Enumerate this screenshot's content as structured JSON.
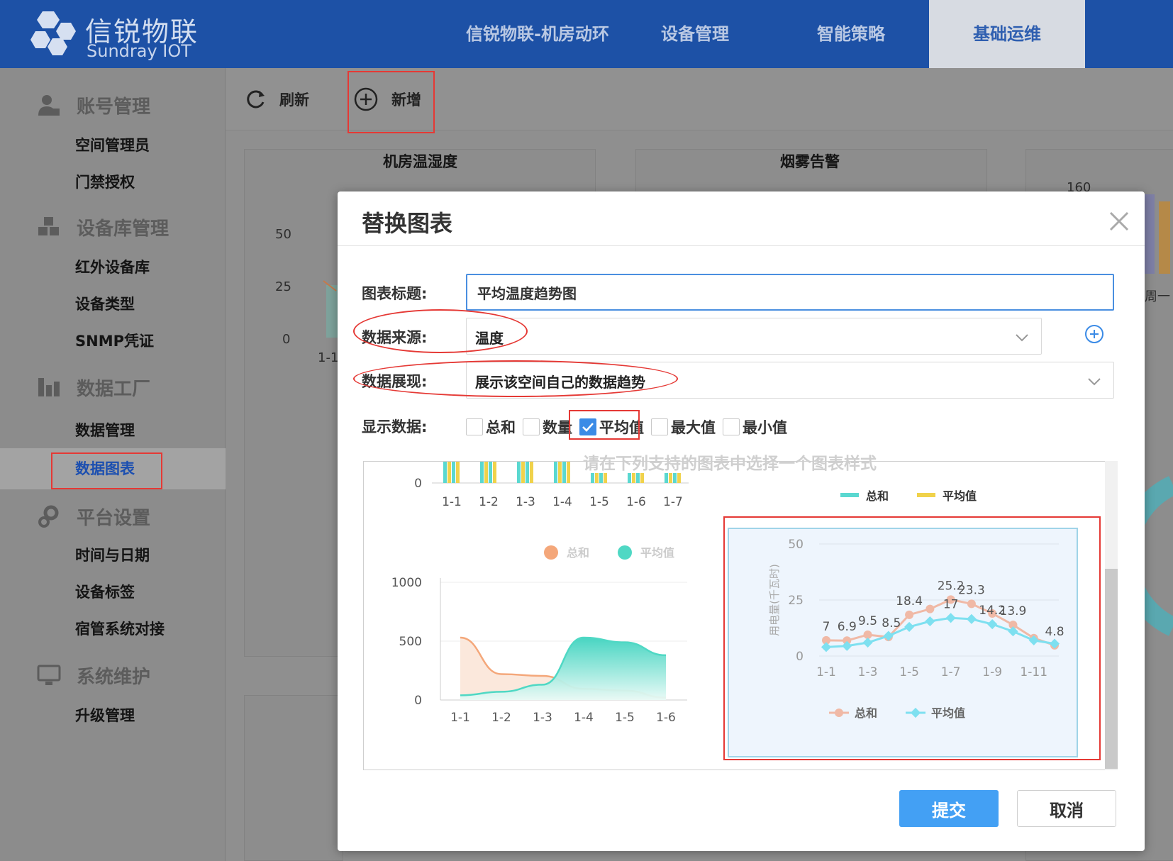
{
  "header": {
    "brand_cn": "信锐物联",
    "brand_en": "Sundray IOT",
    "nav": [
      {
        "label": "信锐物联-机房动环"
      },
      {
        "label": "设备管理"
      },
      {
        "label": "智能策略"
      },
      {
        "label": "基础运维",
        "active": true
      }
    ]
  },
  "sidebar": {
    "groups": [
      {
        "label": "账号管理",
        "icon": "user-icon",
        "items": [
          "空间管理员",
          "门禁授权"
        ]
      },
      {
        "label": "设备库管理",
        "icon": "cubes-icon",
        "items": [
          "红外设备库",
          "设备类型",
          "SNMP凭证"
        ]
      },
      {
        "label": "数据工厂",
        "icon": "chart-icon",
        "items": [
          "数据管理",
          "数据图表"
        ]
      },
      {
        "label": "平台设置",
        "icon": "gears-icon",
        "items": [
          "时间与日期",
          "设备标签",
          "宿管系统对接"
        ]
      },
      {
        "label": "系统维护",
        "icon": "monitor-icon",
        "items": [
          "升级管理"
        ]
      }
    ],
    "active_item": "数据图表"
  },
  "toolbar": {
    "refresh_label": "刷新",
    "add_label": "新增"
  },
  "background_panels": {
    "titles": [
      "机房温湿度",
      "烟雾告警"
    ],
    "left_axis": [
      "50",
      "25",
      "0"
    ],
    "left_x": "1-1",
    "right_axis_top": "160",
    "right_x": "周一"
  },
  "modal": {
    "title": "替换图表",
    "fields": {
      "title_label": "图表标题:",
      "title_value": "平均温度趋势图",
      "source_label": "数据来源:",
      "source_value": "温度",
      "display_label": "数据展现:",
      "display_value": "展示该空间自己的数据趋势",
      "show_label": "显示数据:"
    },
    "checkboxes": [
      {
        "label": "总和",
        "checked": false
      },
      {
        "label": "数量",
        "checked": false
      },
      {
        "label": "平均值",
        "checked": true
      },
      {
        "label": "最大值",
        "checked": false
      },
      {
        "label": "最小值",
        "checked": false
      }
    ],
    "hint": "请在下列支持的图表中选择一个图表样式",
    "submit_label": "提交",
    "cancel_label": "取消"
  },
  "colors": {
    "header_bg": "#1d51a6",
    "primary": "#43a0f4",
    "annotation_red": "#e53935",
    "sum_orange": "#f4a77a",
    "avg_teal": "#4fd8c4",
    "bar_teal": "#5ad8d0",
    "bar_yellow": "#f0d24b",
    "line_pink": "#f0b9a6",
    "line_cyan": "#7ee0f0"
  },
  "chart_data": [
    {
      "type": "bar",
      "categories": [
        "1-1",
        "1-2",
        "1-3",
        "1-4",
        "1-5",
        "1-6",
        "1-7"
      ],
      "ytick_visible": [
        "0"
      ],
      "legend": [
        "总和",
        "平均值"
      ],
      "legend_position": "top-right"
    },
    {
      "type": "area",
      "categories": [
        "1-1",
        "1-2",
        "1-3",
        "1-4",
        "1-5",
        "1-6"
      ],
      "ylim": [
        0,
        1000
      ],
      "yticks": [
        "0",
        "500",
        "1000"
      ],
      "legend": [
        "总和",
        "平均值"
      ],
      "legend_position": "top",
      "series": [
        {
          "name": "总和",
          "values": [
            530,
            220,
            205,
            95,
            80,
            20
          ]
        },
        {
          "name": "平均值",
          "values": [
            40,
            70,
            130,
            530,
            490,
            380
          ]
        }
      ]
    },
    {
      "type": "line",
      "categories": [
        "1-1",
        "1-2",
        "1-3",
        "1-4",
        "1-5",
        "1-6",
        "1-7",
        "1-8",
        "1-9",
        "1-10",
        "1-11",
        "1-12"
      ],
      "xtick_labels": [
        "1-1",
        "1-3",
        "1-5",
        "1-7",
        "1-9",
        "1-11"
      ],
      "ylabel": "用电量(千瓦时)",
      "ylim": [
        0,
        50
      ],
      "yticks": [
        "0",
        "25",
        "50"
      ],
      "legend": [
        "总和",
        "平均值"
      ],
      "legend_position": "bottom",
      "series": [
        {
          "name": "总和",
          "values": [
            7,
            6.9,
            9.5,
            8.5,
            18.4,
            21,
            25.2,
            23.3,
            19,
            13.9,
            8,
            4.8
          ],
          "labels": [
            "7",
            "6.9",
            "9.5",
            "8.5",
            "18.4",
            "",
            "25.2",
            "23.3",
            "",
            "13.9",
            "",
            "4.8"
          ]
        },
        {
          "name": "平均值",
          "values": [
            4,
            4.5,
            6,
            9,
            13,
            15.5,
            17,
            16.5,
            14.2,
            11,
            7,
            5.5
          ],
          "labels": [
            "",
            "",
            "",
            "",
            "",
            "",
            "17",
            "",
            "14.2",
            "",
            "",
            ""
          ]
        }
      ]
    }
  ]
}
